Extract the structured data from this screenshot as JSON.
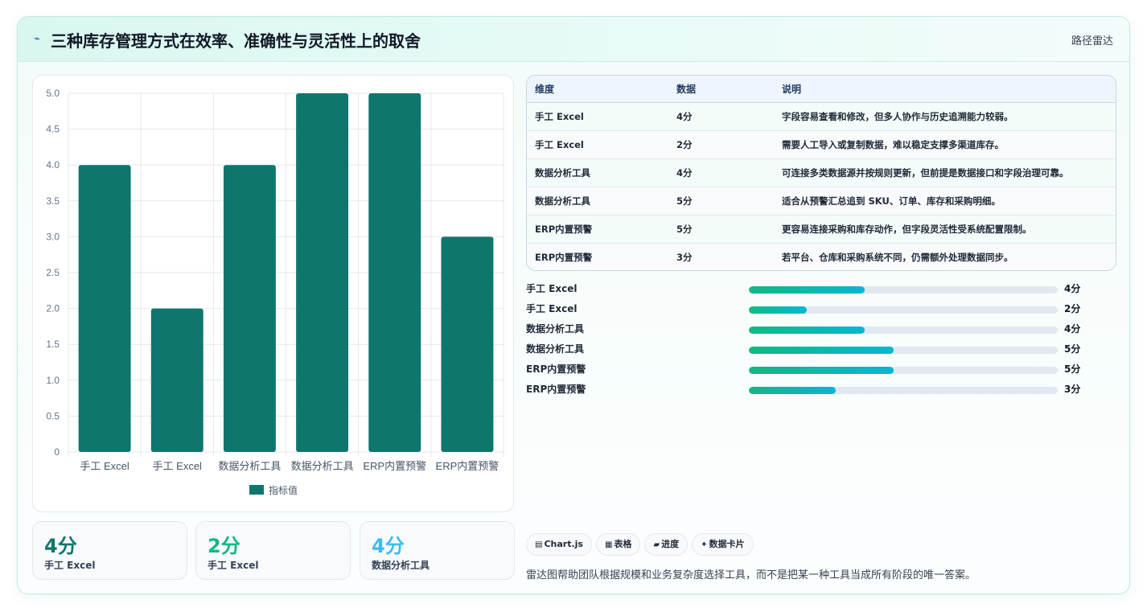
{
  "header": {
    "title": "三种库存管理方式在效率、准确性与灵活性上的取舍",
    "badge": "路径雷达",
    "title_icon": "lightning-icon"
  },
  "chart_data": {
    "type": "bar",
    "categories": [
      "手工 Excel",
      "手工 Excel",
      "数据分析工具",
      "数据分析工具",
      "ERP内置预警",
      "ERP内置预警"
    ],
    "series": [
      {
        "name": "指标值",
        "values": [
          4,
          2,
          4,
          5,
          5,
          3
        ]
      }
    ],
    "ylim": [
      0,
      5
    ],
    "yticks": [
      "0",
      "0.5",
      "1.0",
      "1.5",
      "2.0",
      "2.5",
      "3.0",
      "3.5",
      "4.0",
      "4.5",
      "5.0"
    ],
    "grid": true,
    "legend": "bottom",
    "bar_color": "#0f766e"
  },
  "stats": [
    {
      "value": "4分",
      "label": "手工 Excel",
      "color": "#0f766e"
    },
    {
      "value": "2分",
      "label": "手工 Excel",
      "color": "#10b981"
    },
    {
      "value": "4分",
      "label": "数据分析工具",
      "color": "#38bdf8"
    }
  ],
  "table": {
    "headers": [
      "维度",
      "数据",
      "说明"
    ],
    "rows": [
      [
        "手工 Excel",
        "4分",
        "字段容易查看和修改，但多人协作与历史追溯能力较弱。"
      ],
      [
        "手工 Excel",
        "2分",
        "需要人工导入或复制数据，难以稳定支撑多渠道库存。"
      ],
      [
        "数据分析工具",
        "4分",
        "可连接多类数据源并按规则更新，但前提是数据接口和字段治理可靠。"
      ],
      [
        "数据分析工具",
        "5分",
        "适合从预警汇总追到 SKU、订单、库存和采购明细。"
      ],
      [
        "ERP内置预警",
        "5分",
        "更容易连接采购和库存动作，但字段灵活性受系统配置限制。"
      ],
      [
        "ERP内置预警",
        "3分",
        "若平台、仓库和采购系统不同，仍需额外处理数据同步。"
      ]
    ]
  },
  "progress": [
    {
      "label": "手工 Excel",
      "value": "4分",
      "fraction": 0.376
    },
    {
      "label": "手工 Excel",
      "value": "2分",
      "fraction": 0.188
    },
    {
      "label": "数据分析工具",
      "value": "4分",
      "fraction": 0.376
    },
    {
      "label": "数据分析工具",
      "value": "5分",
      "fraction": 0.47
    },
    {
      "label": "ERP内置预警",
      "value": "5分",
      "fraction": 0.47
    },
    {
      "label": "ERP内置预警",
      "value": "3分",
      "fraction": 0.282
    }
  ],
  "tags": [
    {
      "icon": "▤",
      "label": "Chart.js"
    },
    {
      "icon": "▦",
      "label": "表格"
    },
    {
      "icon": "▰",
      "label": "进度"
    },
    {
      "icon": "✦",
      "label": "数据卡片"
    }
  ],
  "footnote": "雷达图帮助团队根据规模和业务复杂度选择工具，而不是把某一种工具当成所有阶段的唯一答案。"
}
